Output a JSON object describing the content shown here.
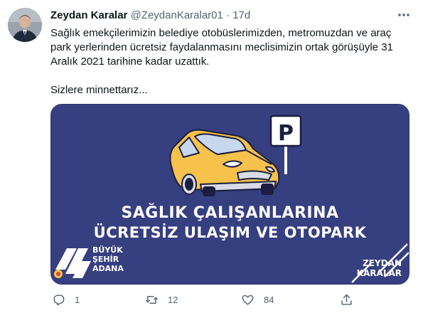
{
  "tweet": {
    "author_name": "Zeydan Karalar",
    "handle": "@ZeydanKaralar01",
    "separator": "·",
    "time": "17d",
    "lines": [
      "Sağlık emekçilerimizin belediye otobüslerimizden, metromuzdan ve araç",
      "park yerlerinden ücretsiz faydalanmasını meclisimizin ortak görüşüyle 31",
      "Aralık 2021 tarihine kadar uzattık."
    ],
    "closing": "Sizlere minnettarız..."
  },
  "media": {
    "background": "#363f7f",
    "car_color": "#f7c24b",
    "parking_letter": "P",
    "headline_line1": "SAĞLIK ÇALIŞANLARINA",
    "headline_line2": "ÜCRETSİZ ULAŞIM VE OTOPARK",
    "logo_left": [
      "BÜYÜK",
      "ŞEHİR",
      "ADANA"
    ],
    "logo_right": [
      "ZEYDAN",
      "KARALAR"
    ]
  },
  "actions": {
    "reply_count": "1",
    "retweet_count": "12",
    "like_count": "84"
  },
  "icons": [
    "more-icon",
    "reply-icon",
    "retweet-icon",
    "like-icon",
    "share-icon",
    "parking-sign-icon",
    "car-illustration"
  ]
}
